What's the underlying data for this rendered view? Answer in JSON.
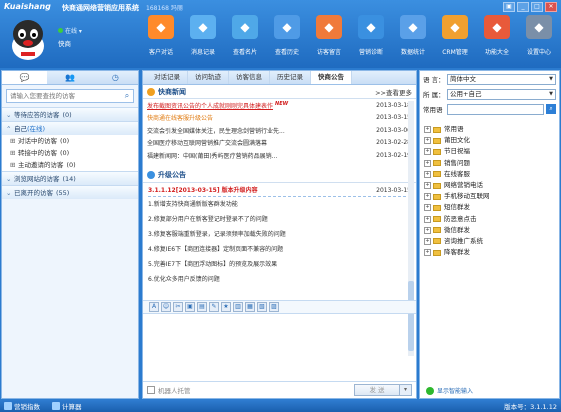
{
  "app": {
    "logo_text": "Kuaishang",
    "title": "快商通网络营销应用系统",
    "version": "168168",
    "version_suffix": "玛丽",
    "status": "在线",
    "username": "快商"
  },
  "toolbar": [
    {
      "label": "客户对话",
      "icon": "chat-icon",
      "color": "#ff8a2a"
    },
    {
      "label": "消息记录",
      "icon": "message-record-icon",
      "color": "#5cb0f0"
    },
    {
      "label": "查看名片",
      "icon": "business-card-icon",
      "color": "#4fa8e8"
    },
    {
      "label": "查看历史",
      "icon": "history-icon",
      "color": "#4f9be6"
    },
    {
      "label": "访客留言",
      "icon": "leave-message-icon",
      "color": "#f07a3a"
    },
    {
      "label": "营销诊断",
      "icon": "diagnosis-icon",
      "color": "#3a90e0"
    },
    {
      "label": "数据统计",
      "icon": "statistics-icon",
      "color": "#5aa0e8"
    },
    {
      "label": "CRM管理",
      "icon": "crm-icon",
      "color": "#f0a030"
    },
    {
      "label": "功能大全",
      "icon": "function-icon",
      "color": "#e85a3a"
    },
    {
      "label": "设置中心",
      "icon": "settings-icon",
      "color": "#7a8fa8"
    }
  ],
  "left": {
    "search_placeholder": "请输入您要查找的访客",
    "groups": [
      {
        "label": "等待应答的访客",
        "count": "(0)",
        "open": false
      },
      {
        "label": "自己",
        "online": "(在线)",
        "open": true,
        "subs": [
          {
            "label": "对话中的访客",
            "count": "(0)"
          },
          {
            "label": "转接中的访客",
            "count": "(0)"
          },
          {
            "label": "主动邀请的访客",
            "count": "(0)"
          }
        ]
      },
      {
        "label": "浏览网站的访客",
        "count": "(14)",
        "open": false
      },
      {
        "label": "已离开的访客",
        "count": "(55)",
        "open": false
      }
    ]
  },
  "center": {
    "tabs": [
      "对话记录",
      "访问轨迹",
      "访客信息",
      "历史记录",
      "快商公告"
    ],
    "active_tab": 4,
    "news_title": "快商新闻",
    "more_label": ">>查看更多",
    "news": [
      {
        "title": "发布截图资讯公告的个人成就刚刚完具体建表作",
        "date": "2013-03-18",
        "style": "red",
        "isnew": true,
        "new_label": "NEW"
      },
      {
        "title": "快商通在线客服升级公告",
        "date": "2013-03-15",
        "style": "orange",
        "isnew": false
      },
      {
        "title": "交流会引发全国媒体关注，民生理念剑营销行业先...",
        "date": "2013-03-06",
        "style": "normal",
        "isnew": false
      },
      {
        "title": "全国医疗移动互联网营销推广交流会圆满落幕",
        "date": "2013-02-28",
        "style": "normal",
        "isnew": false
      },
      {
        "title": "福建新闻网：中国(莆田)秀屿医疗营销药品展销...",
        "date": "2013-02-19",
        "style": "normal",
        "isnew": false
      }
    ],
    "upgrade_title": "升级公告",
    "upgrade_first": {
      "title": "3.1.1.12[2013-03-15] 版本升级内容",
      "date": "2013-03-15"
    },
    "upgrade_items": [
      "1.新增支持快商通新版客群发功能",
      "2.修复部分用户在新客登记时登录不了的问题",
      "3.修复客服端重新登录，记录须频率加载失败的问题",
      "4.修复IE6下【商团连接器】定制页面不兼容的问题",
      "5.完善IE7下【商团浮动图标】的预览及展示效果",
      "6.优化众多用户反馈的问题"
    ],
    "editor_buttons": [
      "A",
      "☺",
      "✂",
      "▣",
      "▤",
      "✎",
      "★",
      "▥",
      "▦",
      "▧",
      "▨"
    ],
    "robot_label": "机器人托管",
    "send_label": "发 送"
  },
  "right": {
    "lang_label": "语 言：",
    "lang_value": "简体中文",
    "cat_label": "所 属：",
    "cat_value": "公用+自己",
    "common_label": "常用语",
    "tree": [
      "常用语",
      "莆田文化",
      "节日祝福",
      "销售问题",
      "在线客服",
      "网络营销电话",
      "手机移动互联网",
      "短信群发",
      "防恶意点击",
      "微信群发",
      "咨询推广系统",
      "降客群发"
    ],
    "footer": "显示智能输入"
  },
  "statusbar": {
    "item1": "营销指数",
    "item2": "计算器",
    "version": "版本号：3.1.1.12"
  }
}
